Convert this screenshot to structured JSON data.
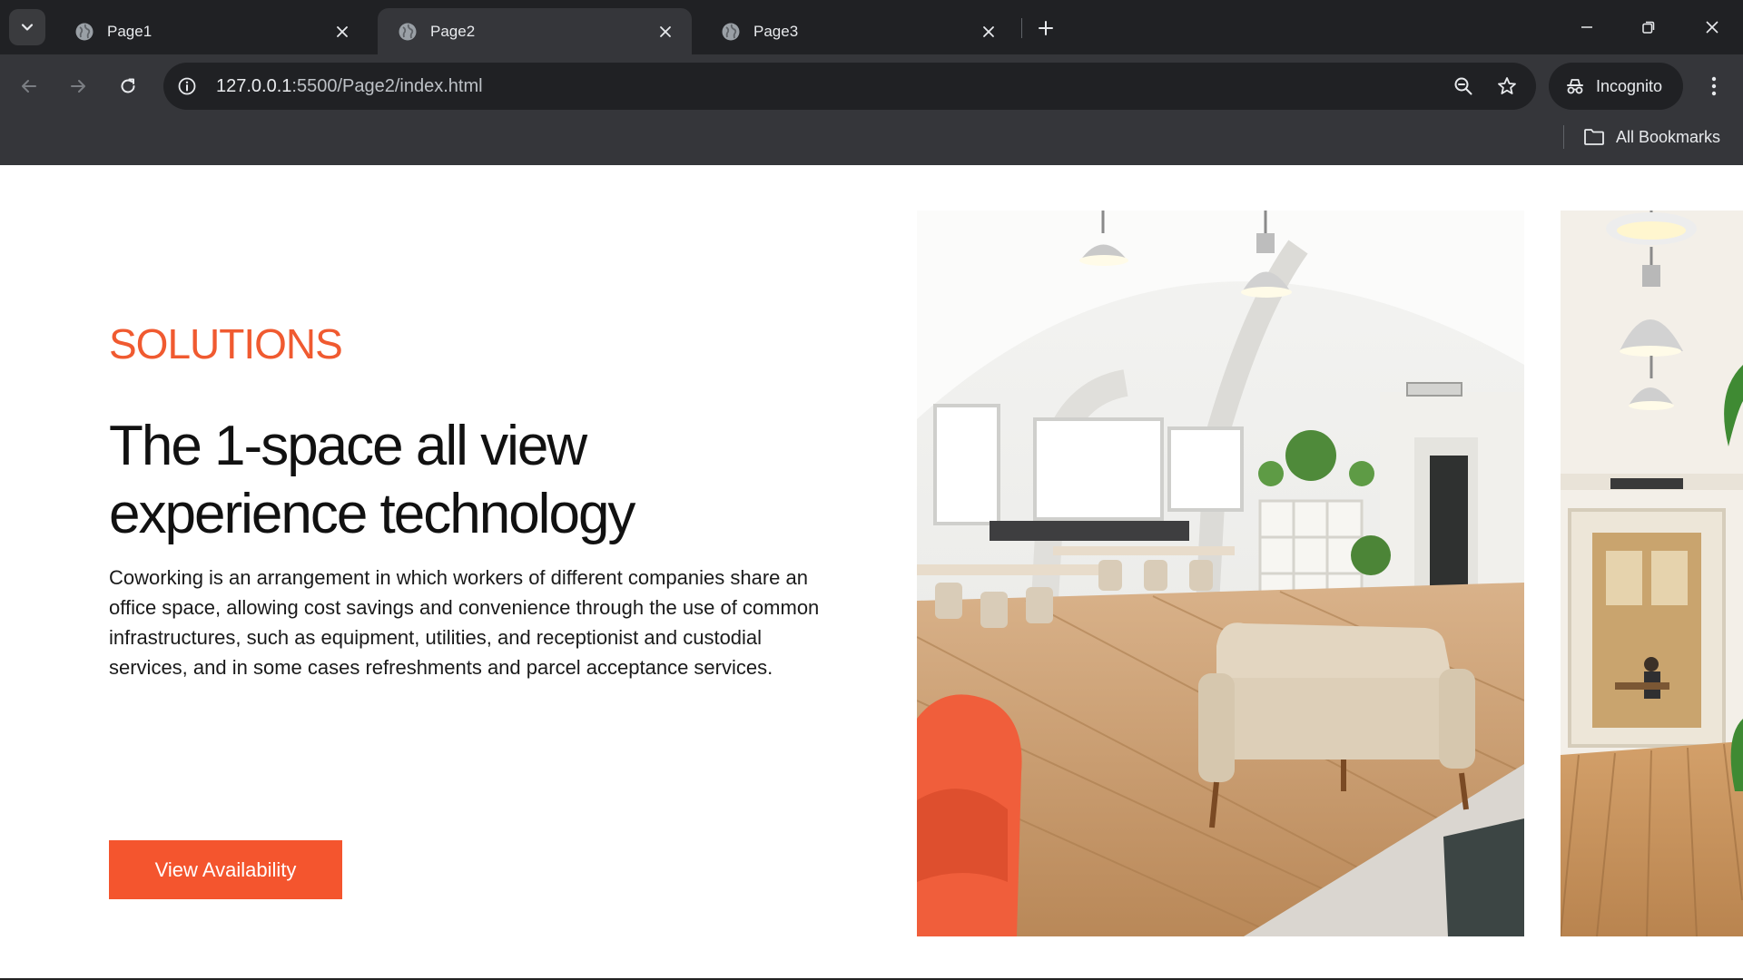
{
  "browser": {
    "tabs": [
      {
        "title": "Page1",
        "active": false
      },
      {
        "title": "Page2",
        "active": true
      },
      {
        "title": "Page3",
        "active": false
      }
    ],
    "url_host": "127.0.0.1",
    "url_rest": ":5500/Page2/index.html",
    "profile_label": "Incognito",
    "bookmarks_label": "All Bookmarks",
    "colors": {
      "frame": "#202124",
      "toolbar": "#35363a",
      "text": "#e8eaed"
    }
  },
  "hero": {
    "eyebrow": "SOLUTIONS",
    "headline": "The 1-space all view experience technology",
    "body": "Coworking is an arrangement in which workers of different companies share an office space, allowing cost savings and convenience through the use of common infrastructures, such as equipment, utilities, and receptionist and custodial services, and in some cases refreshments and parcel acceptance services.",
    "cta_label": "View Availability",
    "colors": {
      "accent": "#f05a30",
      "button": "#f4552e"
    }
  },
  "gallery": {
    "images": [
      "coworking-lounge-photo",
      "coworking-hallway-photo"
    ]
  }
}
